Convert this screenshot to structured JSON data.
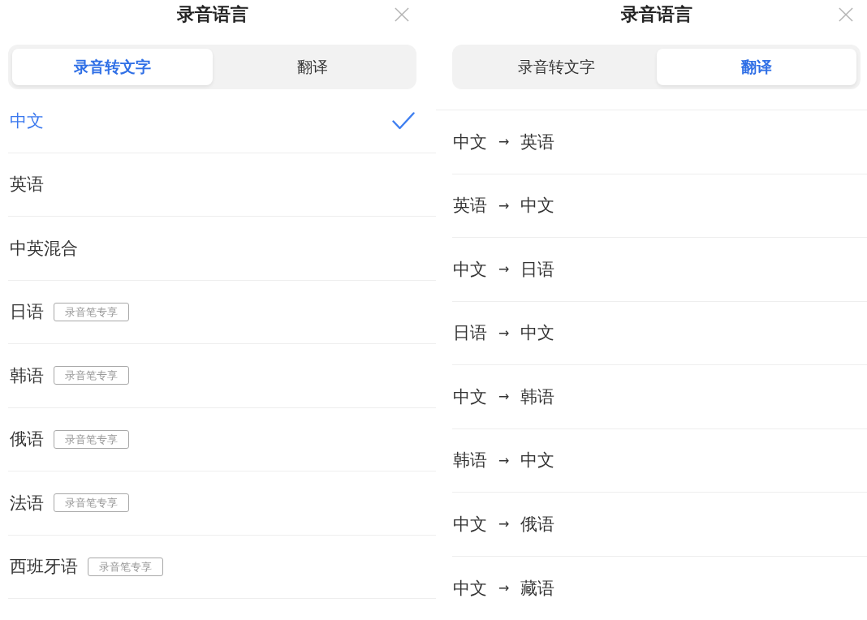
{
  "panels": [
    {
      "kind": "languages",
      "title": "录音语言",
      "tabs": [
        {
          "label": "录音转文字",
          "selected": true
        },
        {
          "label": "翻译",
          "selected": false
        }
      ],
      "items": [
        {
          "label": "中文",
          "selected": true
        },
        {
          "label": "英语",
          "selected": false
        },
        {
          "label": "中英混合",
          "selected": false
        },
        {
          "label": "日语",
          "selected": false,
          "badge": "录音笔专享"
        },
        {
          "label": "韩语",
          "selected": false,
          "badge": "录音笔专享"
        },
        {
          "label": "俄语",
          "selected": false,
          "badge": "录音笔专享"
        },
        {
          "label": "法语",
          "selected": false,
          "badge": "录音笔专享"
        },
        {
          "label": "西班牙语",
          "selected": false,
          "badge": "录音笔专享"
        }
      ]
    },
    {
      "kind": "pairs",
      "title": "录音语言",
      "tabs": [
        {
          "label": "录音转文字",
          "selected": false
        },
        {
          "label": "翻译",
          "selected": true
        }
      ],
      "items": [
        {
          "source": "中文",
          "arrow": "→",
          "target": "英语"
        },
        {
          "source": "英语",
          "arrow": "→",
          "target": "中文"
        },
        {
          "source": "中文",
          "arrow": "→",
          "target": "日语"
        },
        {
          "source": "日语",
          "arrow": "→",
          "target": "中文"
        },
        {
          "source": "中文",
          "arrow": "→",
          "target": "韩语"
        },
        {
          "source": "韩语",
          "arrow": "→",
          "target": "中文"
        },
        {
          "source": "中文",
          "arrow": "→",
          "target": "俄语"
        },
        {
          "source": "中文",
          "arrow": "→",
          "target": "藏语"
        }
      ]
    }
  ]
}
